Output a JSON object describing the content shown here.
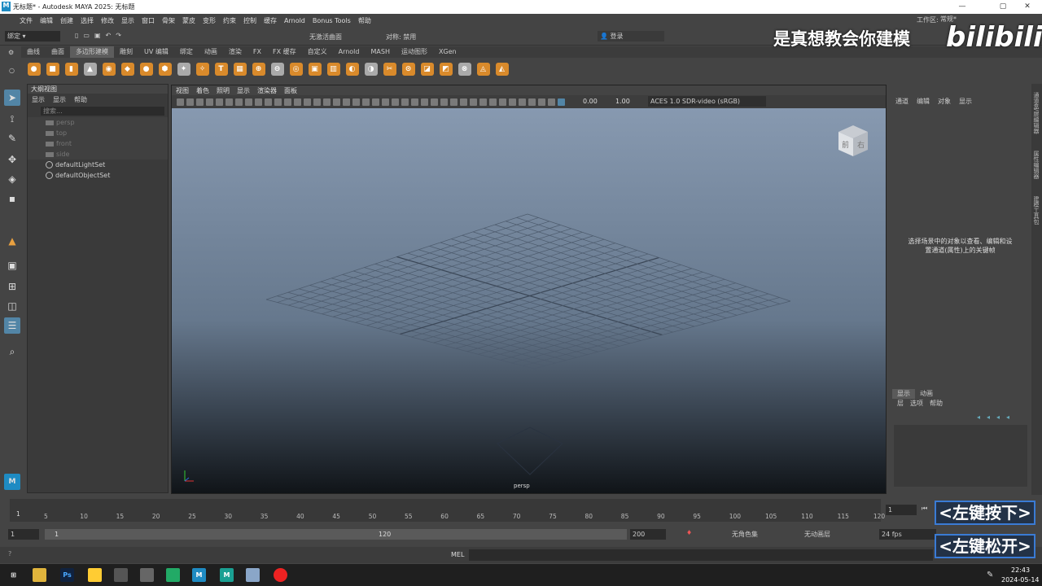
{
  "window": {
    "title": "无标题* - Autodesk MAYA 2025: 无标题",
    "workspace_label": "工作区:",
    "workspace_value": "常规*"
  },
  "menubar": [
    "文件",
    "编辑",
    "创建",
    "选择",
    "修改",
    "显示",
    "窗口",
    "骨架",
    "蒙皮",
    "变形",
    "约束",
    "控制",
    "缓存",
    "Arnold",
    "Bonus Tools",
    "帮助"
  ],
  "statusline": {
    "mode": "绑定",
    "live_surface": "无激活曲面",
    "symmetry": "对称: 禁用",
    "login": "登录"
  },
  "shelf_tabs": [
    "曲线",
    "曲面",
    "多边形建模",
    "雕刻",
    "UV 编辑",
    "绑定",
    "动画",
    "渲染",
    "FX",
    "FX 缓存",
    "自定义",
    "Arnold",
    "MASH",
    "运动图形",
    "XGen"
  ],
  "shelf_active_tab": "多边形建模",
  "shelf_icons": [
    "poly-sphere",
    "poly-cube",
    "poly-cylinder",
    "poly-cone",
    "poly-torus",
    "poly-plane",
    "poly-disc",
    "platonic",
    "sweep",
    "super-shape",
    "type",
    "svg",
    "combine",
    "separate",
    "smooth",
    "extrude",
    "bridge",
    "bevel",
    "insert-edge-loop",
    "multi-cut",
    "target-weld",
    "quad-draw",
    "mirror",
    "boolean",
    "reduce",
    "retopo"
  ],
  "outliner": {
    "title": "大纲视图",
    "menu": [
      "显示",
      "显示",
      "帮助"
    ],
    "search_placeholder": "搜索...",
    "items": [
      {
        "label": "persp",
        "dim": true
      },
      {
        "label": "top",
        "dim": true
      },
      {
        "label": "front",
        "dim": true
      },
      {
        "label": "side",
        "dim": true
      },
      {
        "label": "defaultLightSet",
        "dim": false
      },
      {
        "label": "defaultObjectSet",
        "dim": false
      }
    ]
  },
  "viewport": {
    "menu": [
      "视图",
      "着色",
      "照明",
      "显示",
      "渲染器",
      "面板"
    ],
    "exposure": "0.00",
    "gamma": "1.00",
    "color_space": "ACES 1.0 SDR-video (sRGB)",
    "camera_label": "persp",
    "viewcube_front": "前",
    "viewcube_right": "右"
  },
  "channel_box": {
    "menu": [
      "通道",
      "编辑",
      "对象",
      "显示"
    ],
    "message_line1": "选择场景中的对象以查看、编辑和设",
    "message_line2": "置通道(属性)上的关键帧"
  },
  "side_tabs": [
    "通道盒/层编辑器",
    "属性编辑器",
    "建模工具包"
  ],
  "layer_editor": {
    "tabs": [
      "显示",
      "动画"
    ],
    "menu": [
      "层",
      "选项",
      "帮助"
    ]
  },
  "timeline": {
    "ticks": [
      "5",
      "10",
      "15",
      "20",
      "25",
      "30",
      "35",
      "40",
      "45",
      "50",
      "55",
      "60",
      "65",
      "70",
      "75",
      "80",
      "85",
      "90",
      "95",
      "100",
      "105",
      "110",
      "115",
      "120"
    ],
    "start_tick": "1",
    "current_frame": "1",
    "end_cut": "12"
  },
  "range": {
    "start": "1",
    "inner_start": "1",
    "inner_end": "120",
    "end": "200",
    "character_set": "无角色集",
    "anim_layer": "无动画层",
    "fps": "24 fps"
  },
  "command_line": {
    "lang": "MEL"
  },
  "overlay": {
    "watermark": "是真想教会你建模",
    "bili": "bilibili",
    "key_down": "<左键按下>",
    "key_up": "<左键松开>"
  },
  "taskbar": {
    "time": "22:43",
    "date": "2024-05-14",
    "apps": [
      "Ps",
      "M",
      "M"
    ]
  }
}
